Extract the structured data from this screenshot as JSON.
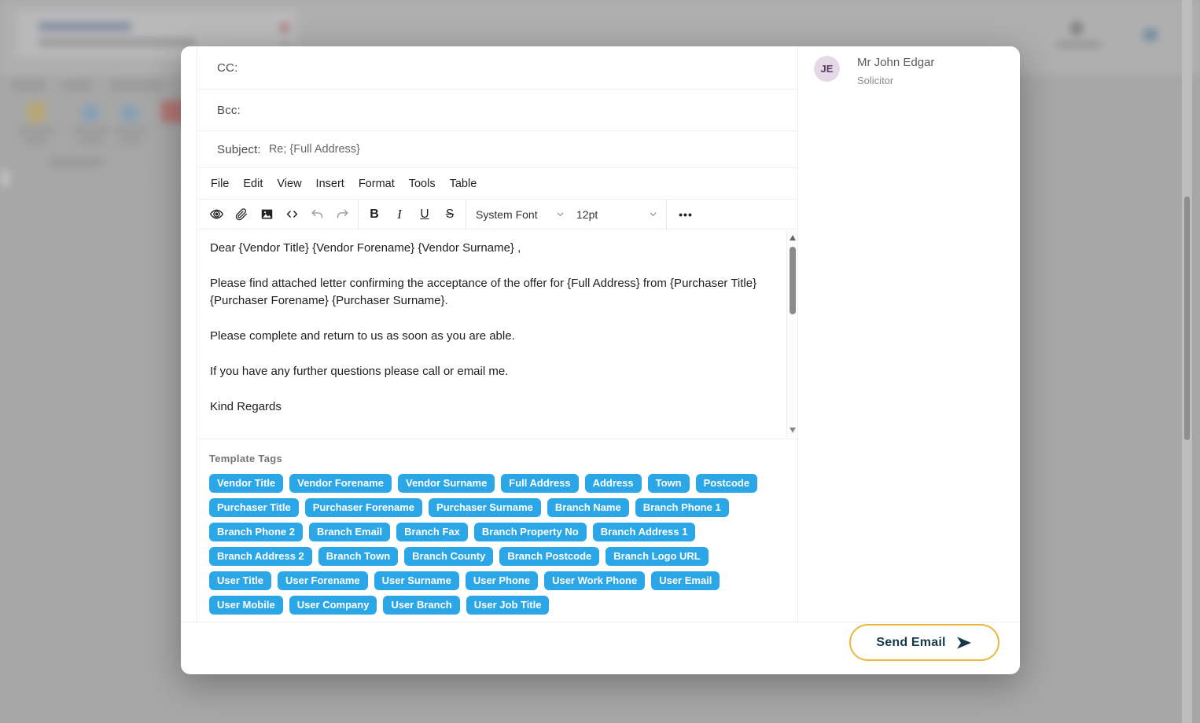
{
  "modal": {
    "fields": {
      "cc_label": "CC:",
      "cc_value": "",
      "bcc_label": "Bcc:",
      "bcc_value": "",
      "subject_label": "Subject:",
      "subject_value": "Re; {Full Address}"
    },
    "editor": {
      "menu": [
        "File",
        "Edit",
        "View",
        "Insert",
        "Format",
        "Tools",
        "Table"
      ],
      "font_name": "System Font",
      "font_size": "12pt",
      "toolbar_icons": [
        "preview-icon",
        "attach-icon",
        "image-icon",
        "source-code-icon",
        "undo-icon",
        "redo-icon",
        "bold",
        "italic",
        "underline",
        "strikethrough",
        "more-dots"
      ],
      "bold_label": "B",
      "italic_label": "I",
      "underline_label": "U",
      "strikethrough_label": "S",
      "more_label": "•••",
      "body_paragraphs": [
        "Dear {Vendor Title} {Vendor Forename}  {Vendor Surname} ,",
        "Please find attached letter confirming the acceptance of the offer for  {Full Address} from  {Purchaser Title}  {Purchaser Forename} {Purchaser Surname}.",
        "Please complete and return to us as soon as you are able.",
        "If you have any further questions please call or email me.",
        "Kind Regards"
      ]
    },
    "template_tags": {
      "label": "Template Tags",
      "tags": [
        "Vendor Title",
        "Vendor Forename",
        "Vendor Surname",
        "Full Address",
        "Address",
        "Town",
        "Postcode",
        "Purchaser Title",
        "Purchaser Forename",
        "Purchaser Surname",
        "Branch Name",
        "Branch Phone 1",
        "Branch Phone 2",
        "Branch Email",
        "Branch Fax",
        "Branch Property No",
        "Branch Address 1",
        "Branch Address 2",
        "Branch Town",
        "Branch County",
        "Branch Postcode",
        "Branch Logo URL",
        "User Title",
        "User Forename",
        "User Surname",
        "User Phone",
        "User Work Phone",
        "User Email",
        "User Mobile",
        "User Company",
        "User Branch",
        "User Job Title"
      ]
    },
    "profile": {
      "initials": "JE",
      "name": "Mr John Edgar",
      "role": "Solicitor"
    },
    "send_button": {
      "label": "Send Email"
    }
  },
  "colors": {
    "tag_blue": "#2BA7E8",
    "send_border_gold": "#EAB93E",
    "send_text_navy": "#16384A",
    "avatar_bg": "#E6D9E7",
    "avatar_text": "#5C3B68"
  }
}
